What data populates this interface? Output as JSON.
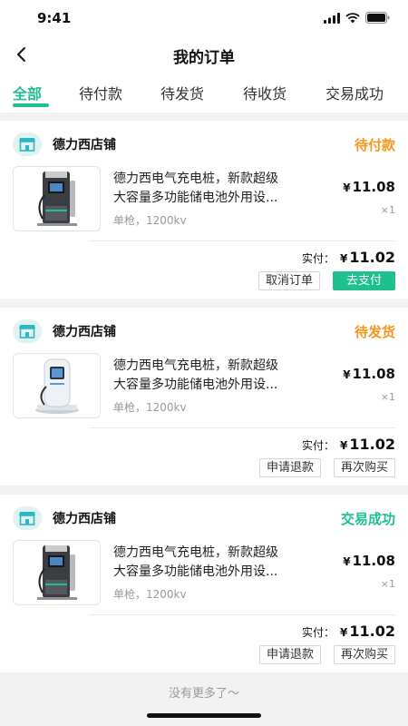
{
  "status_bar": {
    "time": "9:41"
  },
  "nav": {
    "title": "我的订单",
    "back_icon": "chevron-left-icon"
  },
  "tabs": [
    {
      "label": "全部",
      "active": true
    },
    {
      "label": "待付款",
      "active": false
    },
    {
      "label": "待发货",
      "active": false
    },
    {
      "label": "待收货",
      "active": false
    },
    {
      "label": "交易成功",
      "active": false
    }
  ],
  "orders": [
    {
      "shop_name": "德力西店铺",
      "status": "待付款",
      "status_color": "#f5961e",
      "product": {
        "title_line1": "德力西电气充电桩，新款超级",
        "title_line2": "大容量多功能储电池外用设...",
        "spec": "单枪，1200kv",
        "currency": "¥",
        "price": "11.08",
        "qty": "×1",
        "image": "dark-charging-pile"
      },
      "paid_label": "实付：",
      "paid_currency": "¥",
      "paid_amount": "11.02",
      "buttons": [
        {
          "label": "取消订单",
          "primary": false
        },
        {
          "label": "去支付",
          "primary": true
        }
      ]
    },
    {
      "shop_name": "德力西店铺",
      "status": "待发货",
      "status_color": "#f5961e",
      "product": {
        "title_line1": "德力西电气充电桩，新款超级",
        "title_line2": "大容量多功能储电池外用设...",
        "spec": "单枪，1200kv",
        "currency": "¥",
        "price": "11.08",
        "qty": "×1",
        "image": "white-charging-pile"
      },
      "paid_label": "实付：",
      "paid_currency": "¥",
      "paid_amount": "11.02",
      "buttons": [
        {
          "label": "申请退款",
          "primary": false
        },
        {
          "label": "再次购买",
          "primary": false
        }
      ]
    },
    {
      "shop_name": "德力西店铺",
      "status": "交易成功",
      "status_color": "#1fbf8f",
      "product": {
        "title_line1": "德力西电气充电桩，新款超级",
        "title_line2": "大容量多功能储电池外用设...",
        "spec": "单枪，1200kv",
        "currency": "¥",
        "price": "11.08",
        "qty": "×1",
        "image": "dark-charging-pile"
      },
      "paid_label": "实付：",
      "paid_currency": "¥",
      "paid_amount": "11.02",
      "buttons": [
        {
          "label": "申请退款",
          "primary": false
        },
        {
          "label": "再次购买",
          "primary": false
        }
      ]
    }
  ],
  "footer": {
    "no_more": "没有更多了～"
  },
  "colors": {
    "accent": "#1fbf8f",
    "pending": "#f5961e"
  }
}
